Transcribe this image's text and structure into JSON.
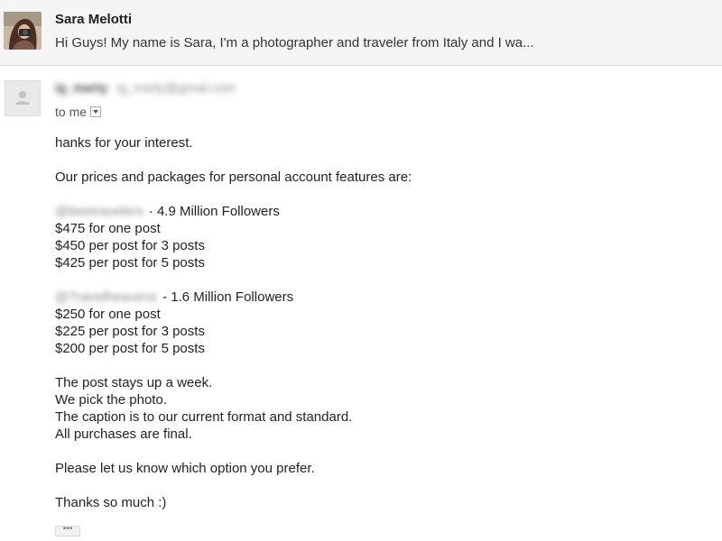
{
  "header": {
    "sender_name": "Sara Melotti",
    "snippet": "Hi Guys! My name is Sara, I'm a photographer and traveler from Italy and I wa..."
  },
  "message": {
    "from_name": "ig_marty",
    "from_email": "ig_marty@gmail.com",
    "to_label": "to me",
    "greeting": "hanks for your interest.",
    "intro": "Our prices and packages for personal account features are:",
    "packages": [
      {
        "handle": "@beetravelers",
        "followers": "4.9 Million Followers",
        "separator": "·",
        "prices": [
          "$475 for one post",
          "$450 per post for 3 posts",
          "$425 per post for 5 posts"
        ]
      },
      {
        "handle": "@Travelheavens",
        "followers": "1.6 Million Followers",
        "separator": "-",
        "prices": [
          "$250 for one post",
          "$225 per post for 3 posts",
          "$200 per post for 5 posts"
        ]
      }
    ],
    "terms": [
      "The post stays up a week.",
      "We pick the photo.",
      "The caption is to our current format and standard.",
      "All purchases are final."
    ],
    "cta": "Please let us know which option you prefer.",
    "signoff": "Thanks so much :)",
    "show_trimmed": "•••"
  }
}
